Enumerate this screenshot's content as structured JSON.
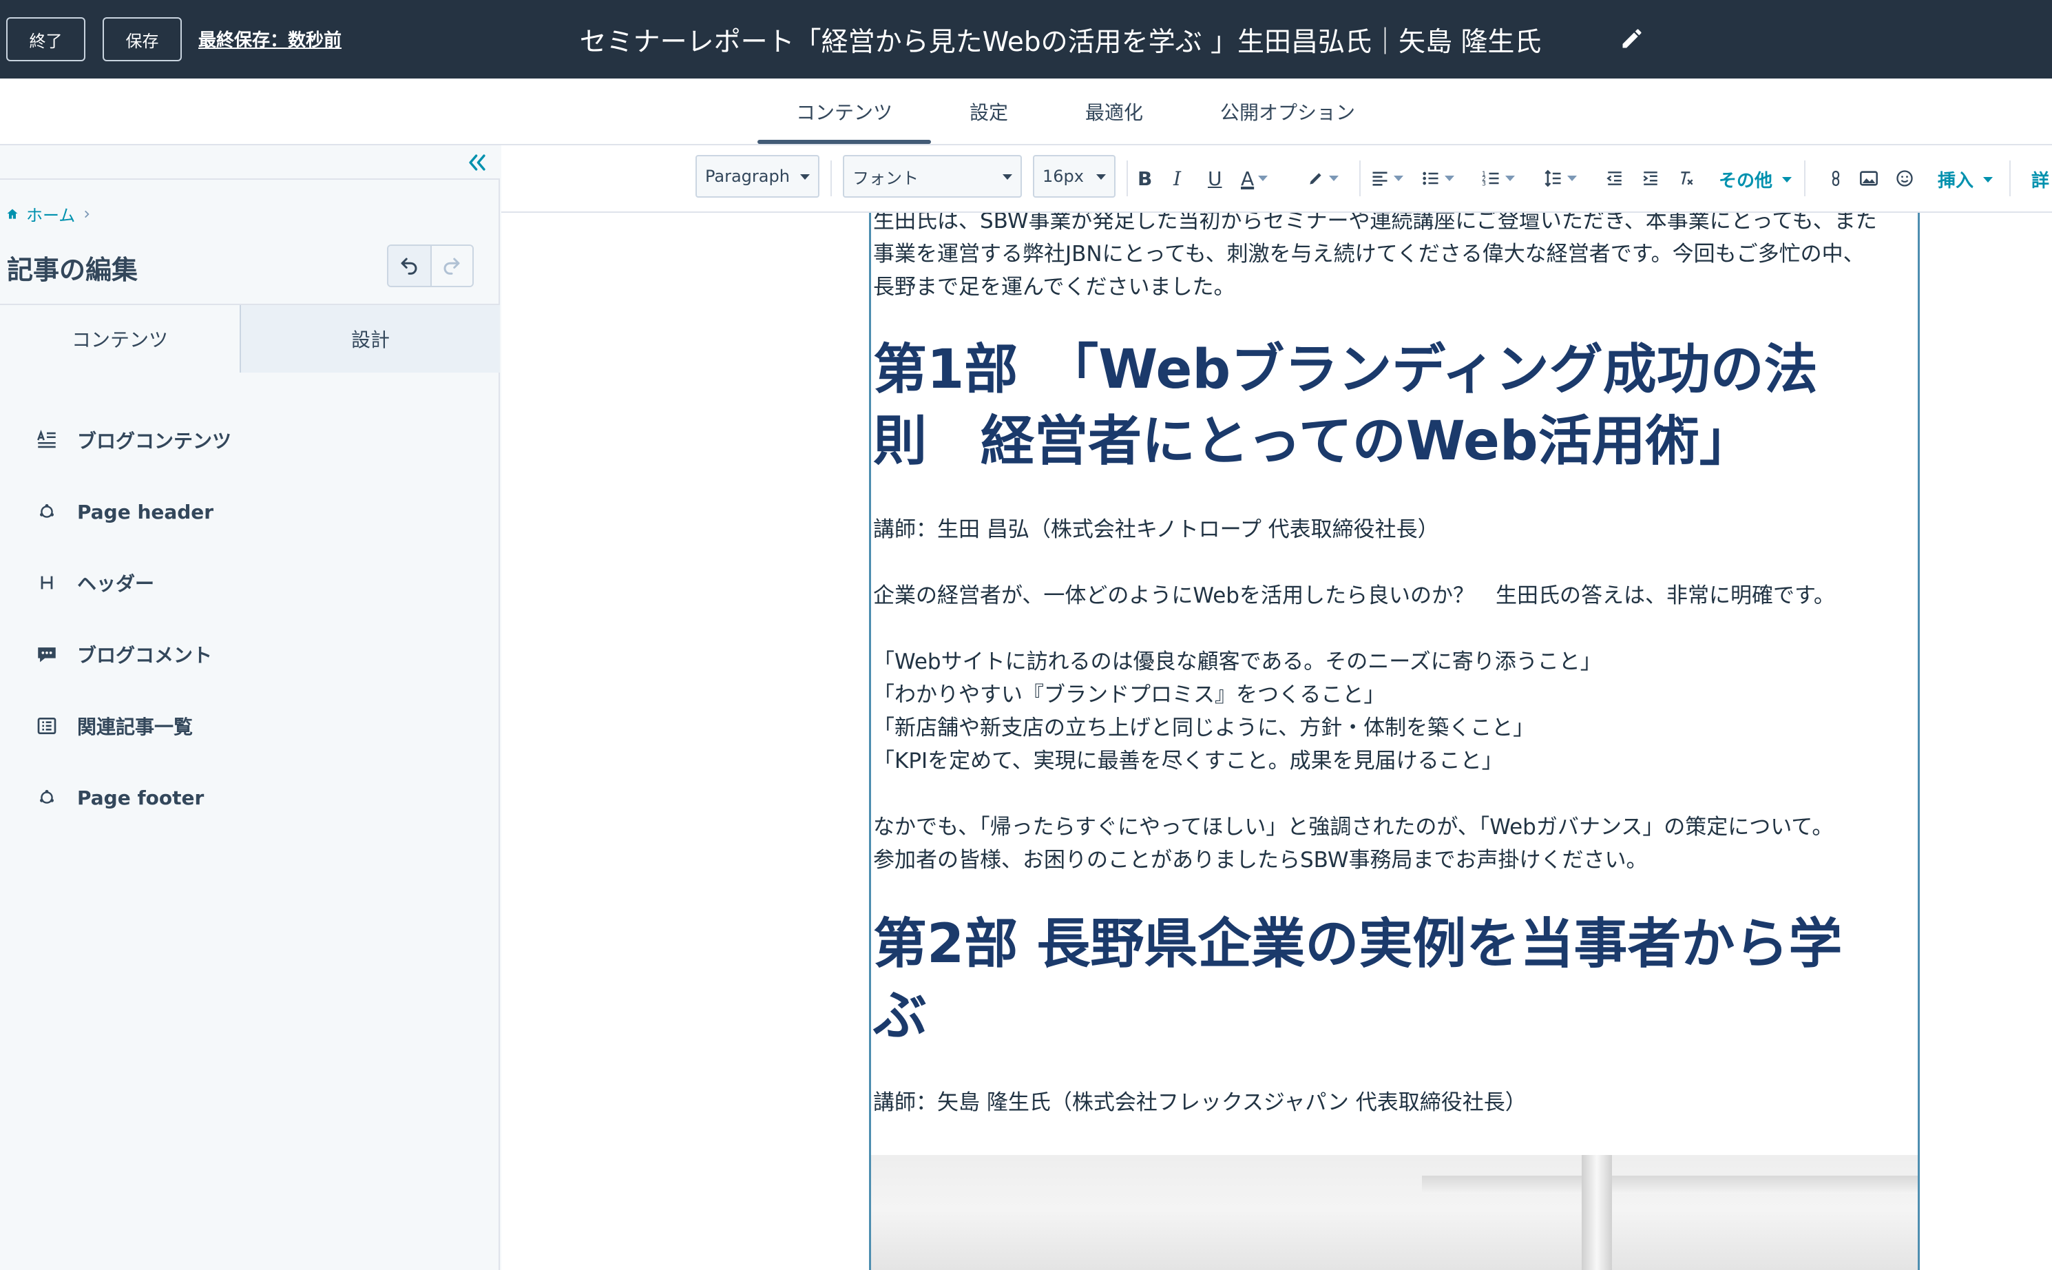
{
  "topbar": {
    "exit_label": "終了",
    "save_label": "保存",
    "last_saved": "最終保存：数秒前",
    "title": "セミナーレポート「経営から見たWebの活用を学ぶ 」生田昌弘氏｜矢島 隆生氏"
  },
  "tabs": [
    {
      "label": "コンテンツ",
      "active": true
    },
    {
      "label": "設定"
    },
    {
      "label": "最適化"
    },
    {
      "label": "公開オプション"
    }
  ],
  "sidebar": {
    "breadcrumb": "ホーム",
    "panel_title": "記事の編集",
    "sub_tabs": [
      "コンテンツ",
      "設計"
    ],
    "items": [
      {
        "label": "ブログコンテンツ",
        "icon": "text-icon"
      },
      {
        "label": "Page header",
        "icon": "module-icon"
      },
      {
        "label": "ヘッダー",
        "icon": "heading-icon"
      },
      {
        "label": "ブログコメント",
        "icon": "comment-icon"
      },
      {
        "label": "関連記事一覧",
        "icon": "list-icon"
      },
      {
        "label": "Page footer",
        "icon": "module-icon"
      }
    ]
  },
  "toolbar": {
    "paragraph": "Paragraph",
    "font": "フォント",
    "size": "16px",
    "more": "その他",
    "insert": "挿入",
    "detail": "詳"
  },
  "article": {
    "intro": [
      "生田氏は、SBW事業が発足した当初からセミナーや連続講座にご登壇いただき、本事業にとっても、また",
      "事業を運営する弊社JBNにとっても、刺激を与え続けてくださる偉大な経営者です。今回もご多忙の中、",
      "長野まで足を運んでくださいました。"
    ],
    "h1_part1": [
      "第1部　「Webブランディング成功の法",
      "則　経営者にとってのWeb活用術」"
    ],
    "lecturer1": "講師：生田 昌弘（株式会社キノトロープ 代表取締役社長）",
    "question": "企業の経営者が、一体どのようにWebを活用したら良いのか？　生田氏の答えは、非常に明確です。",
    "points": [
      "「Webサイトに訪れるのは優良な顧客である。そのニーズに寄り添うこと」",
      "「わかりやすい『ブランドプロミス』をつくること」",
      "「新店舗や新支店の立ち上げと同じように、方針・体制を築くこと」",
      "「KPIを定めて、実現に最善を尽くすこと。成果を見届けること」"
    ],
    "governance": [
      "なかでも、「帰ったらすぐにやってほしい」と強調されたのが、「Webガバナンス」の策定について。",
      "参加者の皆様、お困りのことがありましたらSBW事務局までお声掛けください。"
    ],
    "h1_part2": [
      "第2部 長野県企業の実例を当事者から学",
      "ぶ"
    ],
    "lecturer2": "講師：矢島 隆生氏（株式会社フレックスジャパン 代表取締役社長）"
  }
}
